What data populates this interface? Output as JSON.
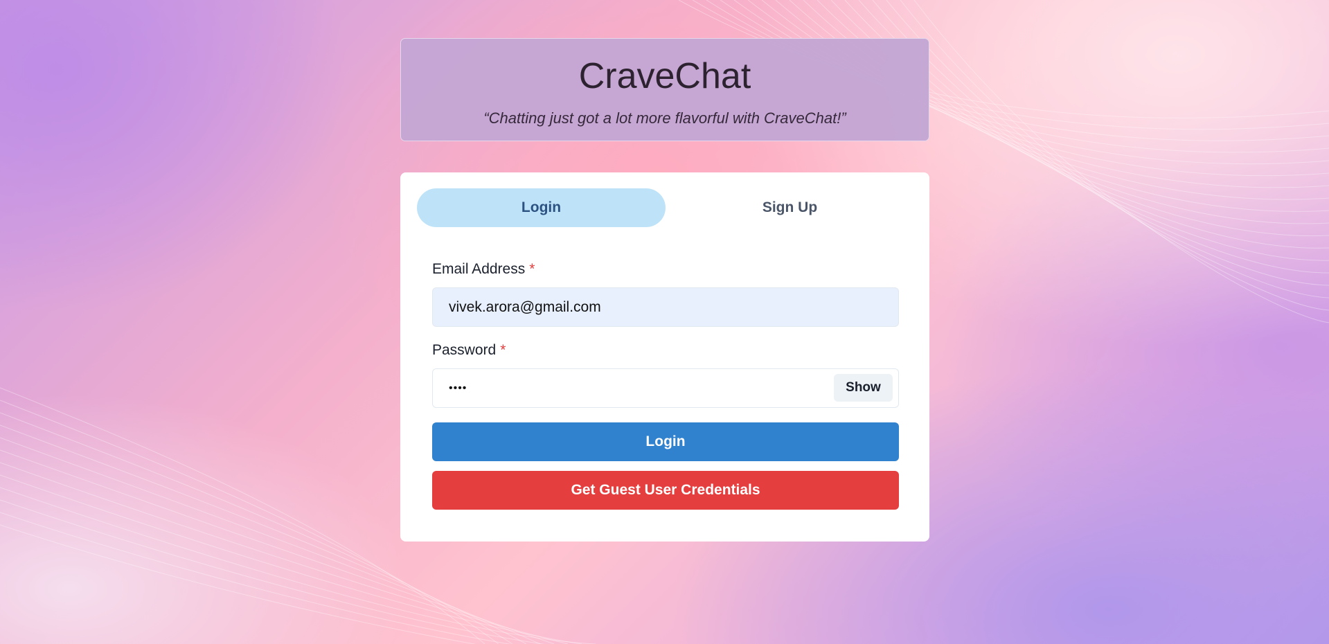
{
  "header": {
    "title": "CraveChat",
    "tagline": "“Chatting just got a lot more flavorful with CraveChat!”"
  },
  "tabs": [
    {
      "label": "Login",
      "active": true
    },
    {
      "label": "Sign Up",
      "active": false
    }
  ],
  "form": {
    "email": {
      "label": "Email Address",
      "required_mark": "*",
      "value": "vivek.arora@gmail.com"
    },
    "password": {
      "label": "Password",
      "required_mark": "*",
      "masked_value": "••••",
      "toggle_label": "Show"
    },
    "login_button": "Login",
    "guest_button": "Get Guest User Credentials"
  },
  "colors": {
    "tab_active_bg": "#bee3f8",
    "primary": "#3182ce",
    "danger": "#e53e3e",
    "header_bg": "#c4a6d4"
  }
}
